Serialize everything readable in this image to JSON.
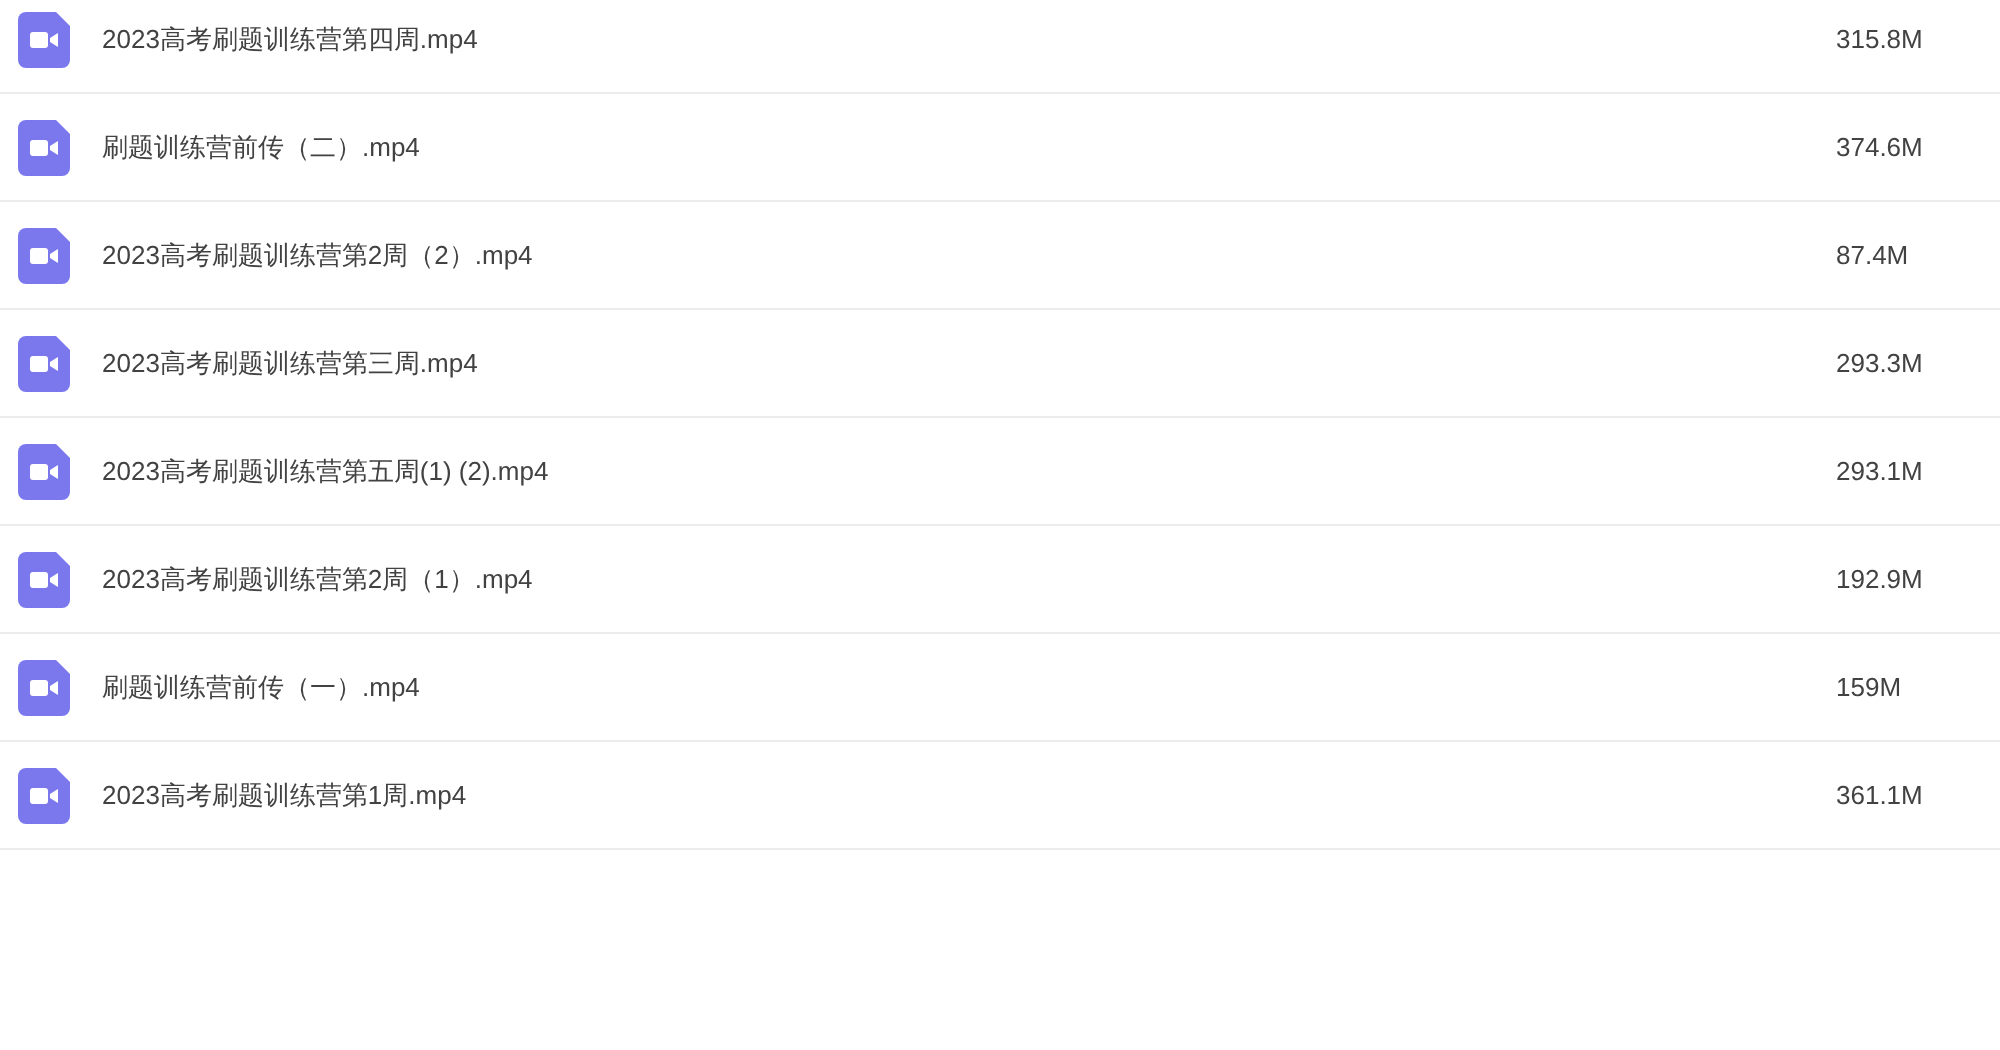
{
  "files": [
    {
      "name": "2023高考刷题训练营第四周.mp4",
      "size": "315.8M"
    },
    {
      "name": "刷题训练营前传（二）.mp4",
      "size": "374.6M"
    },
    {
      "name": "2023高考刷题训练营第2周（2）.mp4",
      "size": "87.4M"
    },
    {
      "name": "2023高考刷题训练营第三周.mp4",
      "size": "293.3M"
    },
    {
      "name": "2023高考刷题训练营第五周(1) (2).mp4",
      "size": "293.1M"
    },
    {
      "name": "2023高考刷题训练营第2周（1）.mp4",
      "size": "192.9M"
    },
    {
      "name": "刷题训练营前传（一）.mp4",
      "size": "159M"
    },
    {
      "name": "2023高考刷题训练营第1周.mp4",
      "size": "361.1M"
    }
  ]
}
